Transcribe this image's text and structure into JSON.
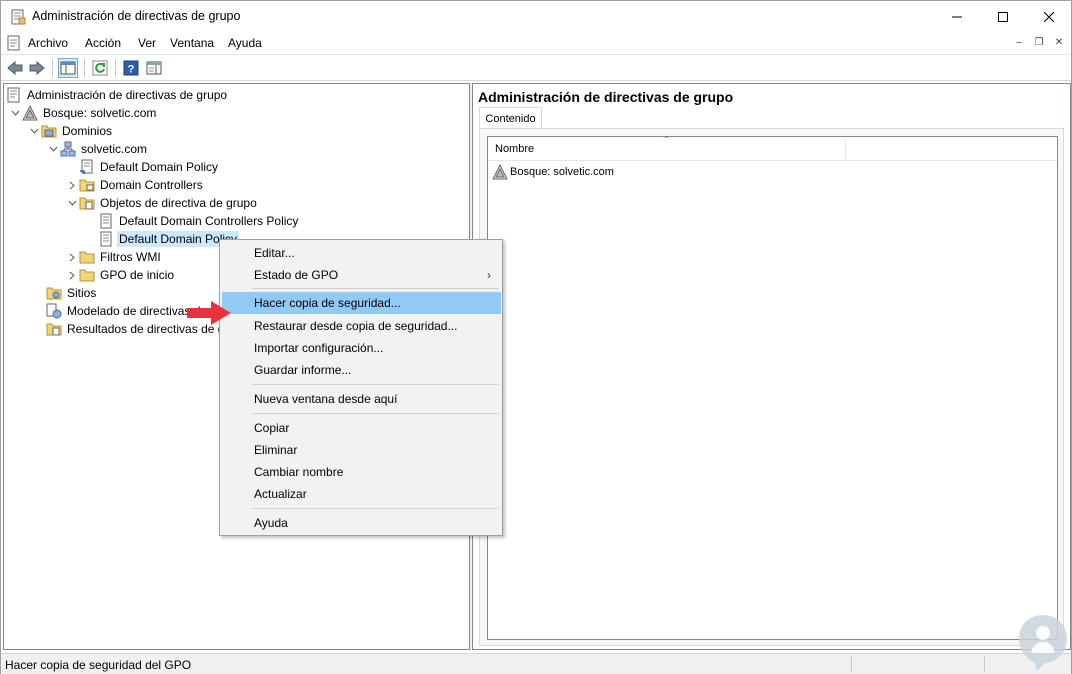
{
  "window": {
    "title": "Administración de directivas de grupo"
  },
  "menubar": {
    "items": [
      "Archivo",
      "Acción",
      "Ver",
      "Ventana",
      "Ayuda"
    ]
  },
  "tree": {
    "root": "Administración de directivas de grupo",
    "forest": "Bosque: solvetic.com",
    "domains": "Dominios",
    "domain": "solvetic.com",
    "ddp": "Default Domain Policy",
    "dc": "Domain Controllers",
    "gpo_objects": "Objetos de directiva de grupo",
    "ddcp": "Default Domain Controllers Policy",
    "ddp_selected": "Default Domain Policy",
    "wmi": "Filtros WMI",
    "starter": "GPO de inicio",
    "sites": "Sitios",
    "modeling": "Modelado de directivas de gr",
    "results": "Resultados de directivas de g"
  },
  "right": {
    "header": "Administración de directivas de grupo",
    "tab": "Contenido",
    "column": "Nombre",
    "row": "Bosque: solvetic.com"
  },
  "context_menu": {
    "items": [
      "Editar...",
      "Estado de GPO",
      "Hacer copia de seguridad...",
      "Restaurar desde copia de seguridad...",
      "Importar configuración...",
      "Guardar informe...",
      "Nueva ventana desde aquí",
      "Copiar",
      "Eliminar",
      "Cambiar nombre",
      "Actualizar",
      "Ayuda"
    ],
    "highlighted": "Hacer copia de seguridad..."
  },
  "statusbar": {
    "text": "Hacer copia de seguridad del GPO"
  },
  "colors": {
    "highlight": "#91c9f7",
    "selection": "#cce8ff",
    "arrow": "#e8323c"
  }
}
